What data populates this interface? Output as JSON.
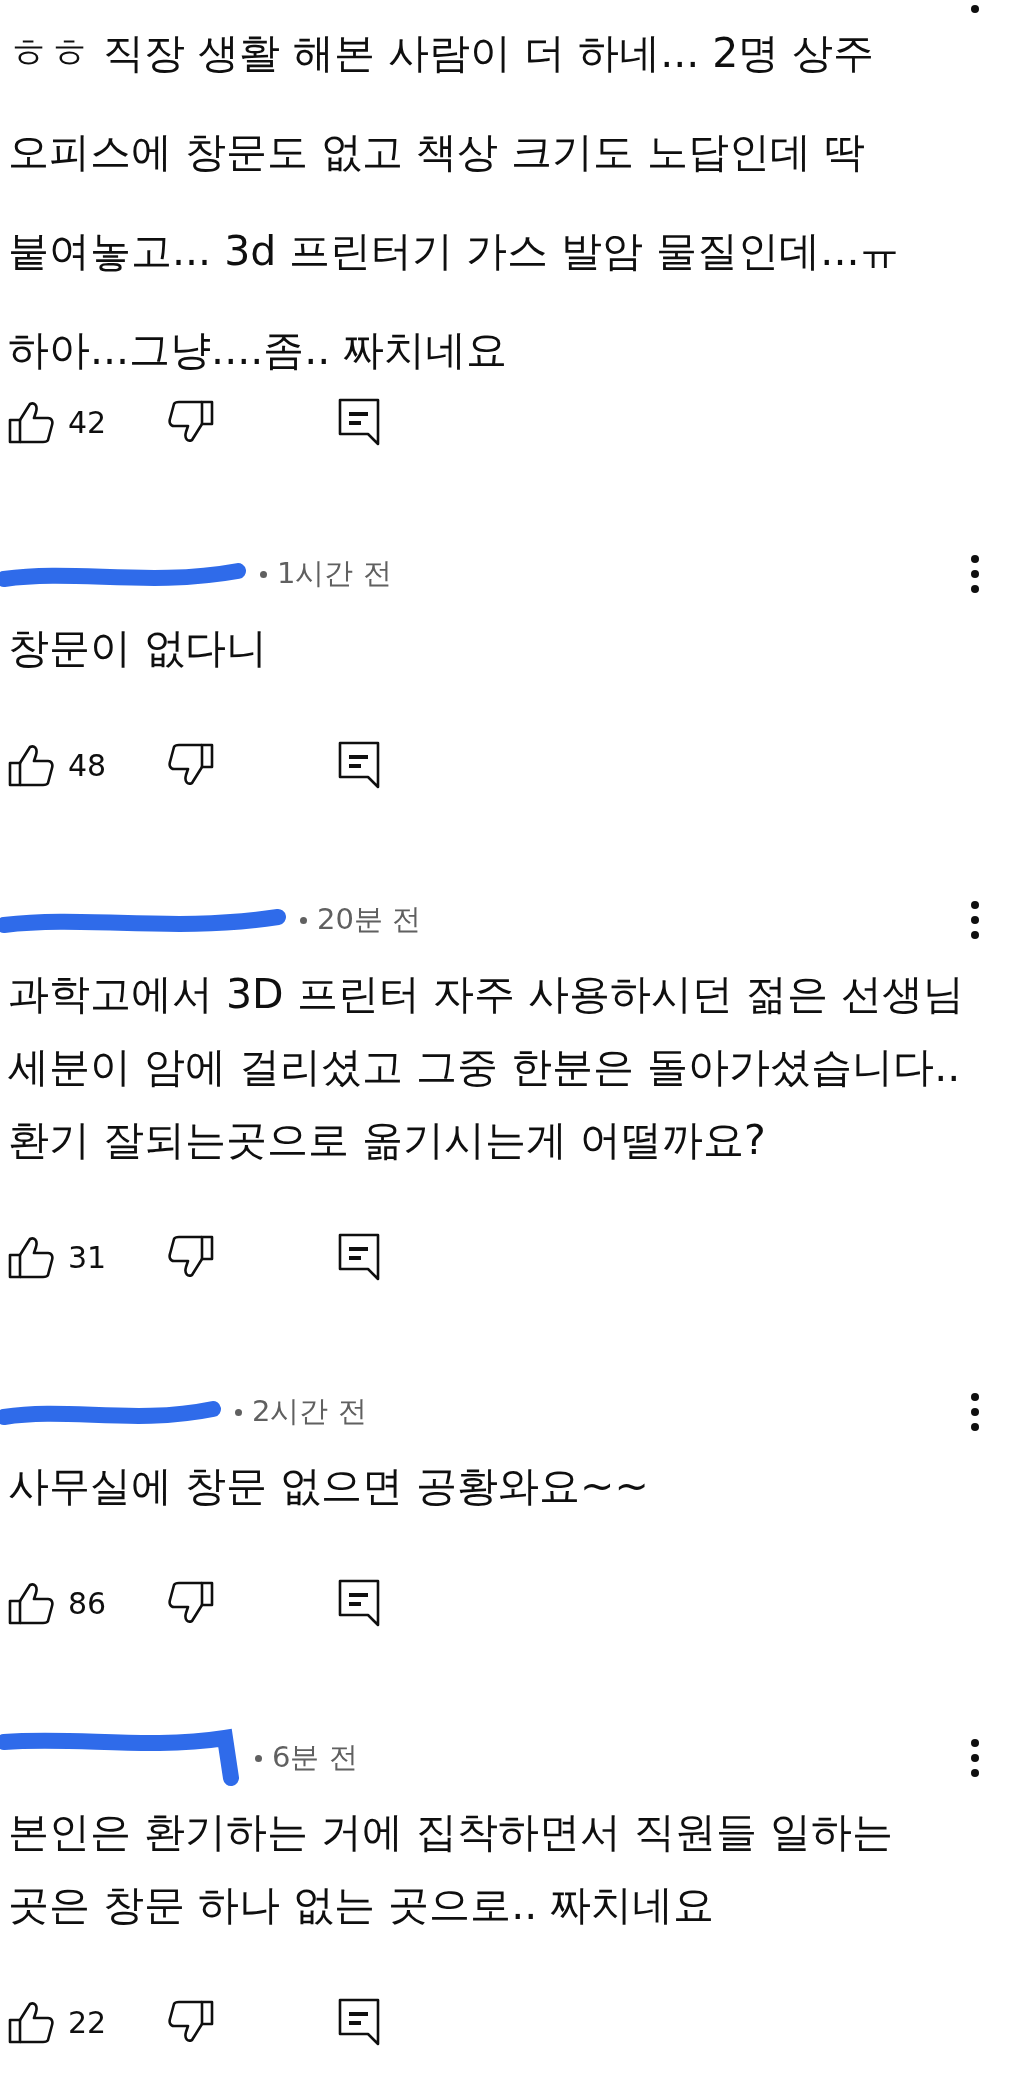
{
  "comments": [
    {
      "text": "ㅎㅎ 직장 생활 해본 사람이 더 하네... 2명 상주\n오피스에 창문도 없고 책상 크기도 노답인데 딱\n붙여놓고... 3d 프린터기 가스 발암 물질인데...ㅠ\n하아...그냥....좀.. 짜치네요",
      "likes": "42"
    },
    {
      "time": "1시간 전",
      "text": "창문이 없다니",
      "likes": "48"
    },
    {
      "time": "20분 전",
      "text": "과학고에서 3D 프린터 자주 사용하시던 젊은 선생님\n세분이 암에 걸리셨고 그중 한분은 돌아가셨습니다..\n환기 잘되는곳으로 옮기시는게 어떨까요?",
      "likes": "31"
    },
    {
      "time": "2시간 전",
      "text": "사무실에 창문 없으면 공황와요~~",
      "likes": "86"
    },
    {
      "time": "6분 전",
      "text": "본인은 환기하는 거에 집착하면서 직원들 일하는\n곳은 창문 하나 없는 곳으로.. 짜치네요",
      "likes": "22"
    }
  ]
}
